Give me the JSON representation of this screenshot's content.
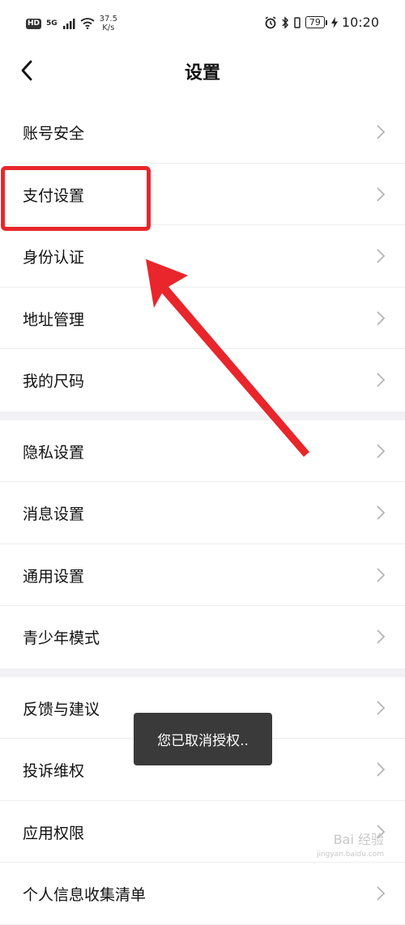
{
  "status_bar": {
    "hd": "HD",
    "network": "5G",
    "speed_value": "37.5",
    "speed_unit": "K/s",
    "battery": "79",
    "time": "10:20"
  },
  "nav": {
    "title": "设置"
  },
  "groups": [
    {
      "items": [
        "账号安全",
        "支付设置",
        "身份认证",
        "地址管理",
        "我的尺码"
      ]
    },
    {
      "items": [
        "隐私设置",
        "消息设置",
        "通用设置",
        "青少年模式"
      ]
    },
    {
      "items": [
        "反馈与建议",
        "投诉维权",
        "应用权限",
        "个人信息收集清单"
      ]
    }
  ],
  "toast": {
    "message": "您已取消授权.."
  },
  "watermark": {
    "brand": "Bai 经验",
    "url": "jingyan.baidu.com"
  },
  "colors": {
    "annotation_red": "#e8262b",
    "toast_bg": "#3a3a3a",
    "group_gap": "#f2f2f4"
  }
}
